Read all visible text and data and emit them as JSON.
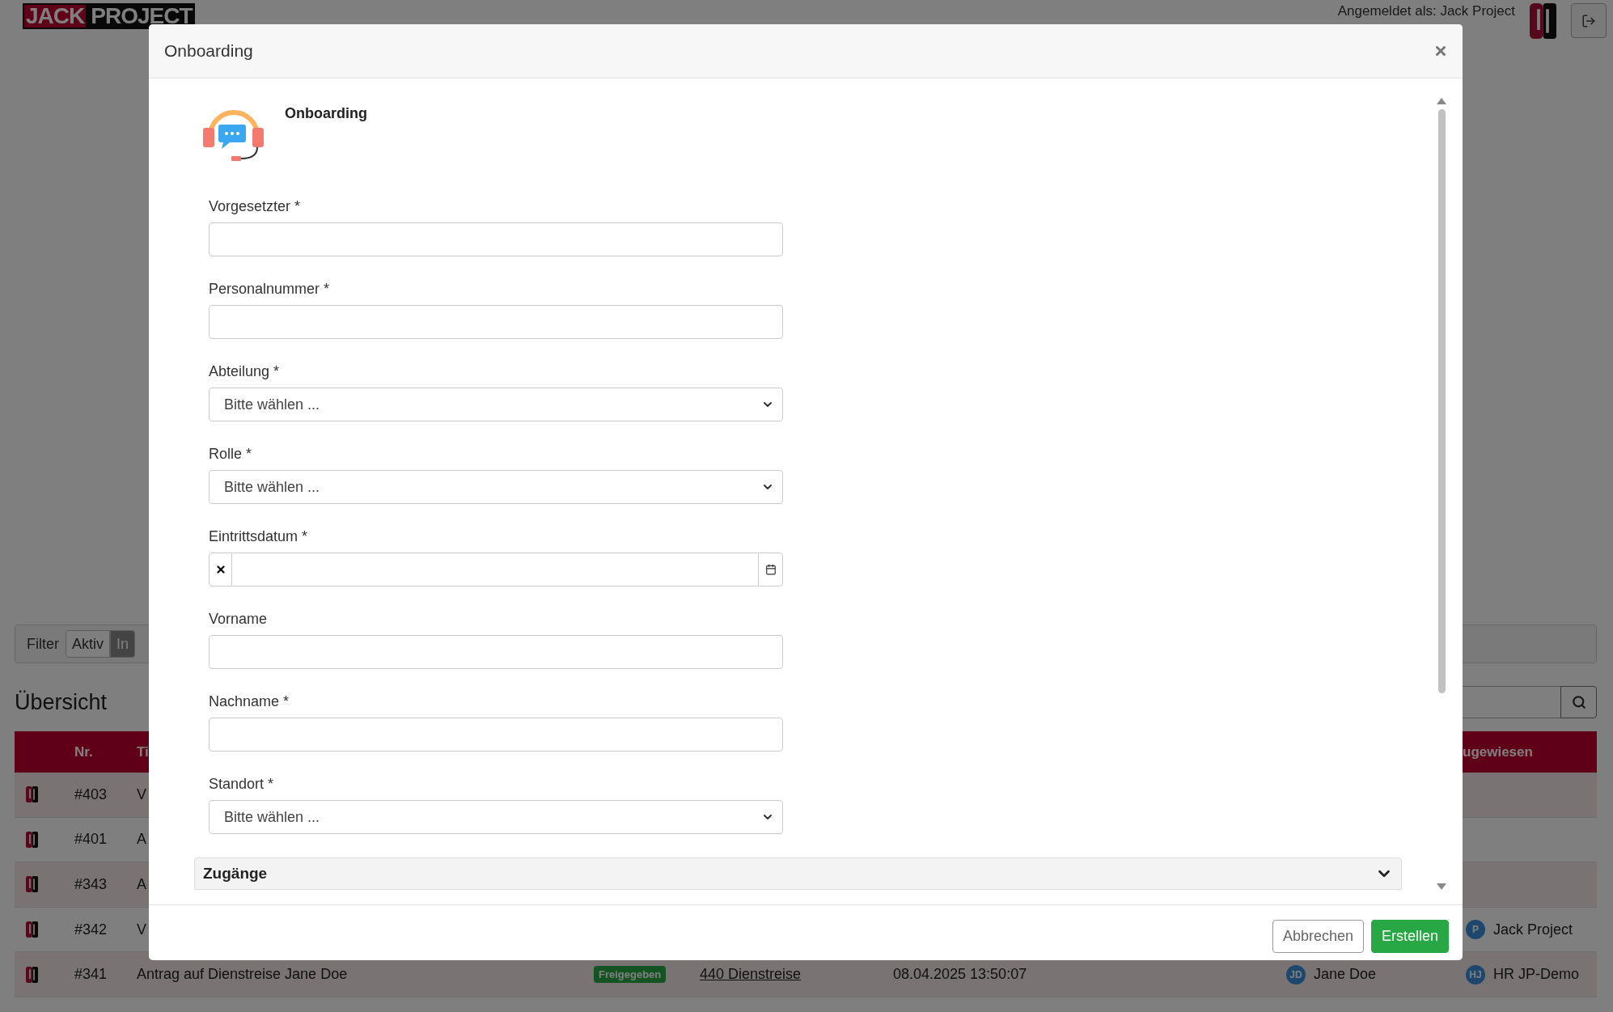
{
  "header": {
    "logo": [
      "JACK",
      "PROJECT"
    ],
    "user_label": "Angemeldet als: Jack Project"
  },
  "filter": {
    "label": "Filter",
    "options": [
      {
        "label": "Aktiv",
        "selected": false
      },
      {
        "label": "In",
        "selected": true
      }
    ]
  },
  "overview": {
    "title": "Übersicht"
  },
  "table": {
    "column_headers": {
      "nr": "Nr.",
      "title": "Ti",
      "assignee": "ugewiesen"
    },
    "rows": [
      {
        "nr": "#403",
        "title": "V"
      },
      {
        "nr": "#401",
        "title": "A"
      },
      {
        "nr": "#343",
        "title": "A"
      },
      {
        "nr": "#342",
        "title": "V",
        "assignee": {
          "initials": "P",
          "name": "Jack Project"
        }
      },
      {
        "nr": "#341",
        "title": "Antrag auf Dienstreise Jane Doe",
        "status": "Freigegeben",
        "category": "440 Dienstreise",
        "date": "08.04.2025 13:50:07",
        "creator": {
          "initials": "JD",
          "name": "Jane Doe"
        },
        "assignee": {
          "initials": "HJ",
          "name": "HR JP-Demo"
        }
      }
    ]
  },
  "modal": {
    "title": "Onboarding",
    "heading": "Onboarding",
    "fields": [
      {
        "kind": "text",
        "label": "Vorgesetzter *"
      },
      {
        "kind": "text",
        "label": "Personalnummer *"
      },
      {
        "kind": "select",
        "label": "Abteilung *",
        "value": "Bitte wählen ..."
      },
      {
        "kind": "select",
        "label": "Rolle *",
        "value": "Bitte wählen ..."
      },
      {
        "kind": "date",
        "label": "Eintrittsdatum *"
      },
      {
        "kind": "text",
        "label": "Vorname"
      },
      {
        "kind": "text",
        "label": "Nachname *"
      },
      {
        "kind": "select",
        "label": "Standort *",
        "value": "Bitte wählen ..."
      }
    ],
    "sections": [
      {
        "title": "Zugänge",
        "expanded": false
      }
    ],
    "buttons": [
      {
        "kind": "secondary",
        "label": "Abbrechen"
      },
      {
        "kind": "primary",
        "label": "Erstellen"
      }
    ]
  }
}
